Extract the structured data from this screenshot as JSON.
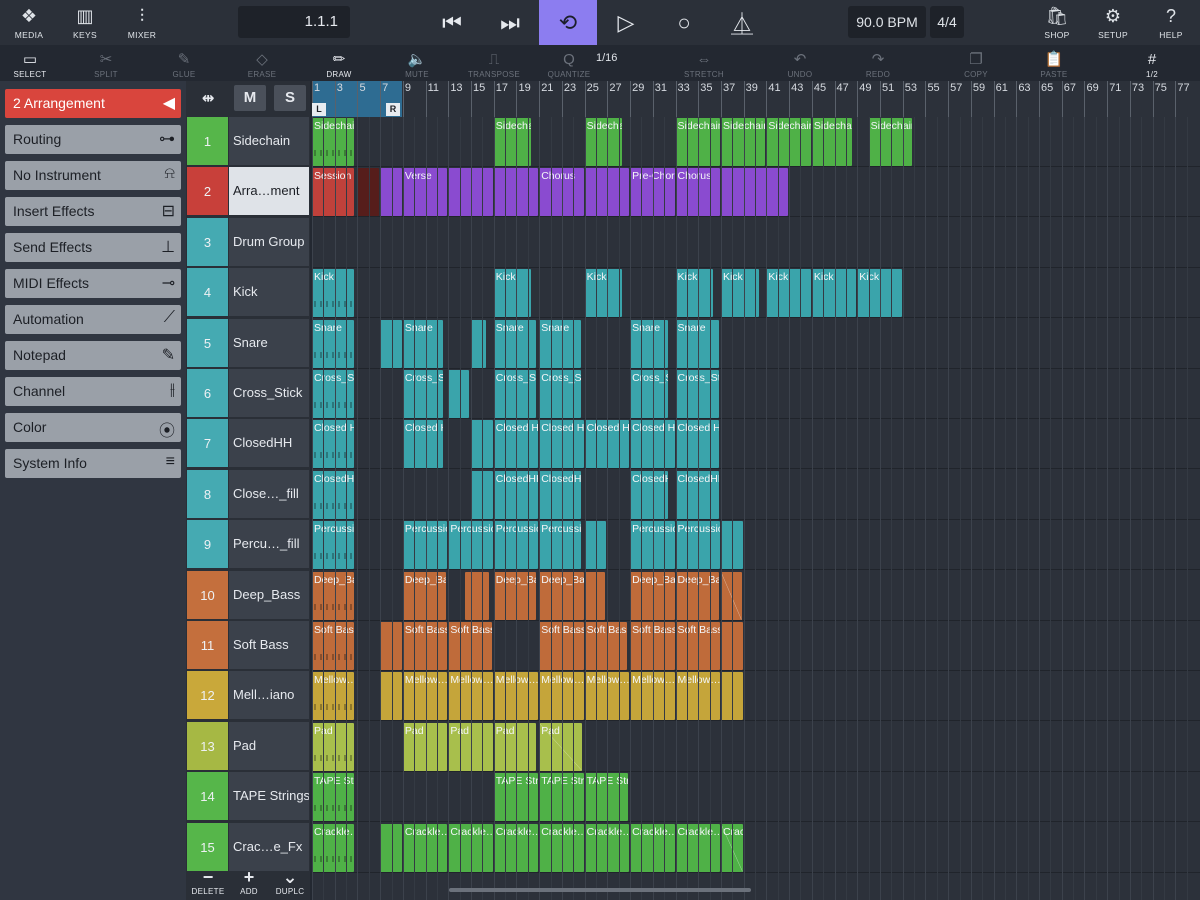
{
  "topbar": {
    "left_buttons": [
      {
        "label": "MEDIA",
        "icon": "media-icon",
        "glyph": "❖"
      },
      {
        "label": "KEYS",
        "icon": "keys-icon",
        "glyph": "▥"
      },
      {
        "label": "MIXER",
        "icon": "mixer-icon",
        "glyph": "⫶"
      }
    ],
    "position": "1.1.1",
    "transport": [
      {
        "name": "rewind-button",
        "icon": "skip-back-icon",
        "glyph": "⏮",
        "active": false
      },
      {
        "name": "forward-button",
        "icon": "skip-forward-icon",
        "glyph": "⏭",
        "active": false
      },
      {
        "name": "loop-button",
        "icon": "loop-icon",
        "glyph": "⟲",
        "active": true
      },
      {
        "name": "play-button",
        "icon": "play-icon",
        "glyph": "▷",
        "active": false
      },
      {
        "name": "record-button",
        "icon": "record-icon",
        "glyph": "○",
        "active": false
      },
      {
        "name": "metronome-button",
        "icon": "metronome-icon",
        "glyph": "⏅",
        "active": false
      }
    ],
    "tempo": "90.0 BPM",
    "signature": "4/4",
    "right_buttons": [
      {
        "label": "SHOP",
        "icon": "shop-icon",
        "glyph": "🛍"
      },
      {
        "label": "SETUP",
        "icon": "gear-icon",
        "glyph": "⚙"
      },
      {
        "label": "HELP",
        "icon": "help-icon",
        "glyph": "?"
      }
    ]
  },
  "tools": [
    {
      "label": "SELECT",
      "icon": "select-icon",
      "glyph": "▭",
      "on": true
    },
    {
      "label": "SPLIT",
      "icon": "split-icon",
      "glyph": "✂",
      "on": false
    },
    {
      "label": "GLUE",
      "icon": "glue-icon",
      "glyph": "✎",
      "on": false
    },
    {
      "label": "ERASE",
      "icon": "eraser-icon",
      "glyph": "◇",
      "on": false
    },
    {
      "label": "DRAW",
      "icon": "pencil-icon",
      "glyph": "✏",
      "on": true
    },
    {
      "label": "MUTE",
      "icon": "mute-icon",
      "glyph": "🔈",
      "on": false
    },
    {
      "label": "TRANSPOSE",
      "icon": "transpose-icon",
      "glyph": "⎍",
      "on": false
    },
    {
      "label": "QUANTIZE",
      "icon": "quantize-icon",
      "glyph": "Q",
      "on": false
    },
    {
      "label": "STRETCH",
      "icon": "stretch-icon",
      "glyph": "⇔",
      "on": false
    },
    {
      "label": "UNDO",
      "icon": "undo-icon",
      "glyph": "↶",
      "on": false
    },
    {
      "label": "REDO",
      "icon": "redo-icon",
      "glyph": "↷",
      "on": false
    },
    {
      "label": "COPY",
      "icon": "copy-icon",
      "glyph": "❐",
      "on": false
    },
    {
      "label": "PASTE",
      "icon": "paste-icon",
      "glyph": "📋",
      "on": false
    },
    {
      "label": "1/2",
      "icon": "grid-icon",
      "glyph": "#",
      "on": true
    }
  ],
  "quantize_value": "1/16",
  "inspector": [
    {
      "label": "2  Arrangement",
      "icon": "collapse-arrow-icon",
      "glyph": "◀"
    },
    {
      "label": "Routing",
      "icon": "routing-icon",
      "glyph": "⊶"
    },
    {
      "label": "No Instrument",
      "icon": "instrument-icon",
      "glyph": "⍾"
    },
    {
      "label": "Insert Effects",
      "icon": "insert-icon",
      "glyph": "⊟"
    },
    {
      "label": "Send Effects",
      "icon": "send-icon",
      "glyph": "⊥"
    },
    {
      "label": "MIDI Effects",
      "icon": "midi-icon",
      "glyph": "⊸"
    },
    {
      "label": "Automation",
      "icon": "automation-icon",
      "glyph": "⟋"
    },
    {
      "label": "Notepad",
      "icon": "notepad-icon",
      "glyph": "✎"
    },
    {
      "label": "Channel",
      "icon": "channel-icon",
      "glyph": "⫲"
    },
    {
      "label": "Color",
      "icon": "color-icon",
      "glyph": "⦿"
    },
    {
      "label": "System Info",
      "icon": "menu-icon",
      "glyph": "≡"
    }
  ],
  "tracklist_header": {
    "arrange_glyph": "⇹",
    "mute": "M",
    "solo": "S"
  },
  "tracks": [
    {
      "num": "1",
      "name": "Sidechain",
      "color": "#56b64a"
    },
    {
      "num": "2",
      "name": "Arra…ment",
      "color": "#c8403a"
    },
    {
      "num": "3",
      "name": "Drum Group",
      "color": "#45aab2"
    },
    {
      "num": "4",
      "name": "Kick",
      "color": "#45aab2"
    },
    {
      "num": "5",
      "name": "Snare",
      "color": "#45aab2"
    },
    {
      "num": "6",
      "name": "Cross_Stick",
      "color": "#45aab2"
    },
    {
      "num": "7",
      "name": "ClosedHH",
      "color": "#45aab2"
    },
    {
      "num": "8",
      "name": "Close…_fill",
      "color": "#45aab2"
    },
    {
      "num": "9",
      "name": "Percu…_fill",
      "color": "#45aab2"
    },
    {
      "num": "10",
      "name": "Deep_Bass",
      "color": "#c46f3d"
    },
    {
      "num": "11",
      "name": "Soft Bass",
      "color": "#c46f3d"
    },
    {
      "num": "12",
      "name": "Mell…iano",
      "color": "#c9a83a"
    },
    {
      "num": "13",
      "name": "Pad",
      "color": "#a6b844"
    },
    {
      "num": "14",
      "name": "TAPE Strings",
      "color": "#56b64a"
    },
    {
      "num": "15",
      "name": "Crac…e_Fx",
      "color": "#56b64a"
    }
  ],
  "footer": [
    {
      "label": "DELETE",
      "icon": "minus-icon",
      "glyph": "−"
    },
    {
      "label": "ADD",
      "icon": "plus-icon",
      "glyph": "+"
    },
    {
      "label": "DUPLC",
      "icon": "duplicate-icon",
      "glyph": "⌄"
    }
  ],
  "ruler": {
    "labels": [
      "1",
      "3",
      "5",
      "7",
      "9",
      "11",
      "13",
      "15",
      "17",
      "19",
      "21",
      "23",
      "25",
      "27",
      "29",
      "31",
      "33",
      "35",
      "37",
      "39",
      "41",
      "43",
      "45",
      "47",
      "49",
      "51",
      "53",
      "55",
      "57",
      "59",
      "61",
      "63",
      "65",
      "67",
      "69",
      "71",
      "73",
      "75",
      "77"
    ],
    "loop_left": "L",
    "loop_right": "R"
  },
  "colors": {
    "green": "#4fb147",
    "teal": "#3aa4ab",
    "red": "#c0413b",
    "purple": "#8a4bd0",
    "orange": "#bf6b3a",
    "mustard": "#c5a53a",
    "olive": "#a8bf4c"
  },
  "clips": [
    {
      "track": 0,
      "color": "green",
      "segments": [
        [
          "Sidechain",
          1,
          4.8,
          1
        ],
        [
          "Sidechain",
          17,
          20.4,
          0
        ],
        [
          "Sidechain",
          25,
          28.4,
          0
        ],
        [
          "Sidechain",
          33,
          37,
          0
        ],
        [
          "Sidechain",
          37,
          41,
          0
        ],
        [
          "Sidechain",
          41,
          45,
          0
        ],
        [
          "Sidechain",
          45,
          48.6,
          0
        ],
        [
          "Sidechain",
          50,
          53.9,
          0
        ]
      ]
    },
    {
      "track": 1,
      "color": "red",
      "segments": [
        [
          "Session",
          1,
          4.8,
          0
        ],
        [
          "",
          5,
          7,
          2
        ]
      ]
    },
    {
      "track": 1,
      "color": "purple",
      "segments": [
        [
          "",
          7,
          9,
          0
        ],
        [
          "Verse",
          9,
          13,
          0
        ],
        [
          "",
          13,
          17,
          0
        ],
        [
          "",
          17,
          21,
          0
        ],
        [
          "Chorus",
          21,
          25,
          0
        ],
        [
          "",
          25,
          29,
          0
        ],
        [
          "Pre-Chorus",
          29,
          33,
          0
        ],
        [
          "Chorus",
          33,
          37,
          0
        ],
        [
          "",
          37,
          43,
          0
        ]
      ]
    },
    {
      "track": 3,
      "color": "teal",
      "segments": [
        [
          "Kick",
          1,
          4.8,
          1
        ],
        [
          "Kick",
          17,
          20.4,
          0
        ],
        [
          "Kick",
          25,
          28.4,
          0
        ],
        [
          "Kick",
          33,
          36.4,
          0
        ],
        [
          "Kick",
          37,
          40.4,
          0
        ],
        [
          "Kick",
          41,
          45,
          0
        ],
        [
          "Kick",
          45,
          49,
          0
        ],
        [
          "Kick",
          49,
          53,
          0
        ]
      ]
    },
    {
      "track": 4,
      "color": "teal",
      "segments": [
        [
          "Snare",
          1,
          4.8,
          1
        ],
        [
          "",
          7,
          9,
          0
        ],
        [
          "Snare",
          9,
          12.6,
          0
        ],
        [
          "",
          15,
          16.4,
          0
        ],
        [
          "Snare",
          17,
          20.8,
          0
        ],
        [
          "Snare",
          21,
          24.8,
          0
        ],
        [
          "Snare",
          29,
          32.4,
          0
        ],
        [
          "Snare",
          33,
          36.9,
          0
        ]
      ]
    },
    {
      "track": 5,
      "color": "teal",
      "segments": [
        [
          "Cross_Stick",
          1,
          4.8,
          1
        ],
        [
          "Cross_Stick",
          9,
          12.6,
          0
        ],
        [
          "",
          13,
          14.9,
          0
        ],
        [
          "Cross_Stick",
          17,
          20.8,
          0
        ],
        [
          "Cross_Stick",
          21,
          24.8,
          0
        ],
        [
          "Cross_Stick",
          29,
          32.4,
          0
        ],
        [
          "Cross_Stick",
          33,
          36.9,
          0
        ]
      ]
    },
    {
      "track": 6,
      "color": "teal",
      "segments": [
        [
          "Closed HH",
          1,
          4.8,
          1
        ],
        [
          "Closed HH",
          9,
          12.6,
          0
        ],
        [
          "",
          15,
          17,
          0
        ],
        [
          "Closed HH",
          17,
          21,
          0
        ],
        [
          "Closed HH",
          21,
          25,
          0
        ],
        [
          "Closed HH",
          25,
          29,
          0
        ],
        [
          "Closed HH",
          29,
          33,
          0
        ],
        [
          "Closed HH",
          33,
          36.9,
          0
        ]
      ]
    },
    {
      "track": 7,
      "color": "teal",
      "segments": [
        [
          "ClosedHH_fill",
          1,
          4.8,
          1
        ],
        [
          "",
          15,
          17,
          0
        ],
        [
          "ClosedHH_fill",
          17,
          21,
          0
        ],
        [
          "ClosedHH_fill",
          21,
          24.8,
          0
        ],
        [
          "ClosedHH_fill",
          29,
          32.4,
          0
        ],
        [
          "ClosedHH_fill",
          33,
          36.9,
          0
        ]
      ]
    },
    {
      "track": 8,
      "color": "teal",
      "segments": [
        [
          "Percussion_fill",
          1,
          4.8,
          1
        ],
        [
          "Percussion_fill",
          9,
          13,
          0
        ],
        [
          "Percussion_fill",
          13,
          17,
          0
        ],
        [
          "Percussion_fill",
          17,
          21,
          0
        ],
        [
          "Percussion_fill",
          21,
          24.8,
          0
        ],
        [
          "",
          25,
          27,
          0
        ],
        [
          "Percussion_fill",
          29,
          33,
          0
        ],
        [
          "Percussion_fill",
          33,
          37,
          0
        ],
        [
          "",
          37,
          39,
          0
        ]
      ]
    },
    {
      "track": 9,
      "color": "orange",
      "segments": [
        [
          "Deep_Bass",
          1,
          4.8,
          1
        ],
        [
          "Deep_Bass",
          9,
          12.9,
          0
        ],
        [
          "",
          14.5,
          16.7,
          0
        ],
        [
          "Deep_Bass",
          17,
          20.8,
          0
        ],
        [
          "Deep_Bass",
          21,
          25,
          0
        ],
        [
          "",
          25,
          26.9,
          0
        ],
        [
          "Deep_Bass",
          29,
          33,
          0
        ],
        [
          "Deep_Bass",
          33,
          36.9,
          0
        ],
        [
          "",
          37,
          38.9,
          3
        ]
      ]
    },
    {
      "track": 10,
      "color": "orange",
      "segments": [
        [
          "Soft Bass",
          1,
          4.8,
          1
        ],
        [
          "",
          7,
          9,
          0
        ],
        [
          "Soft Bass",
          9,
          13,
          0
        ],
        [
          "Soft Bass",
          13,
          16.9,
          0
        ],
        [
          "Soft Bass",
          21,
          25,
          0
        ],
        [
          "Soft Bass",
          25,
          28.8,
          0
        ],
        [
          "Soft Bass",
          29,
          33,
          0
        ],
        [
          "Soft Bass",
          33,
          37,
          0
        ],
        [
          "",
          37,
          39,
          0
        ]
      ]
    },
    {
      "track": 11,
      "color": "mustard",
      "segments": [
        [
          "Mellow… Piano",
          1,
          4.8,
          1
        ],
        [
          "",
          7,
          9,
          0
        ],
        [
          "Mellow… Piano",
          9,
          13,
          0
        ],
        [
          "Mellow… Piano",
          13,
          17,
          0
        ],
        [
          "Mellow… Piano",
          17,
          21,
          0
        ],
        [
          "Mellow… Piano",
          21,
          25,
          0
        ],
        [
          "Mellow… Piano",
          25,
          29,
          0
        ],
        [
          "Mellow… Piano",
          29,
          33,
          0
        ],
        [
          "Mellow… Piano",
          33,
          37,
          0
        ],
        [
          "",
          37,
          39,
          0
        ]
      ]
    },
    {
      "track": 12,
      "color": "olive",
      "segments": [
        [
          "Pad",
          1,
          4.8,
          1
        ],
        [
          "Pad",
          9,
          13,
          0
        ],
        [
          "Pad",
          13,
          17,
          0
        ],
        [
          "Pad",
          17,
          20.8,
          0
        ],
        [
          "Pad",
          21,
          24.9,
          3
        ]
      ]
    },
    {
      "track": 13,
      "color": "green",
      "segments": [
        [
          "TAPE Strings",
          1,
          4.8,
          1
        ],
        [
          "TAPE Strings",
          17,
          21,
          0
        ],
        [
          "TAPE Strings",
          21,
          25,
          0
        ],
        [
          "TAPE Strings",
          25,
          28.9,
          0
        ]
      ]
    },
    {
      "track": 14,
      "color": "green",
      "segments": [
        [
          "Crackle…oise_Fx",
          1,
          4.8,
          1
        ],
        [
          "",
          7,
          9,
          0
        ],
        [
          "Crackle…oise_Fx",
          9,
          13,
          0
        ],
        [
          "Crackle…oise_Fx",
          13,
          17,
          0
        ],
        [
          "Crackle…oise_Fx",
          17,
          21,
          0
        ],
        [
          "Crackle…oise_Fx",
          21,
          25,
          0
        ],
        [
          "Crackle…oise_Fx",
          25,
          29,
          0
        ],
        [
          "Crackle…oise_Fx",
          29,
          33,
          0
        ],
        [
          "Crackle…oise_Fx",
          33,
          37,
          0
        ],
        [
          "Crackle…oise_Fx",
          37,
          39,
          3
        ]
      ]
    }
  ]
}
